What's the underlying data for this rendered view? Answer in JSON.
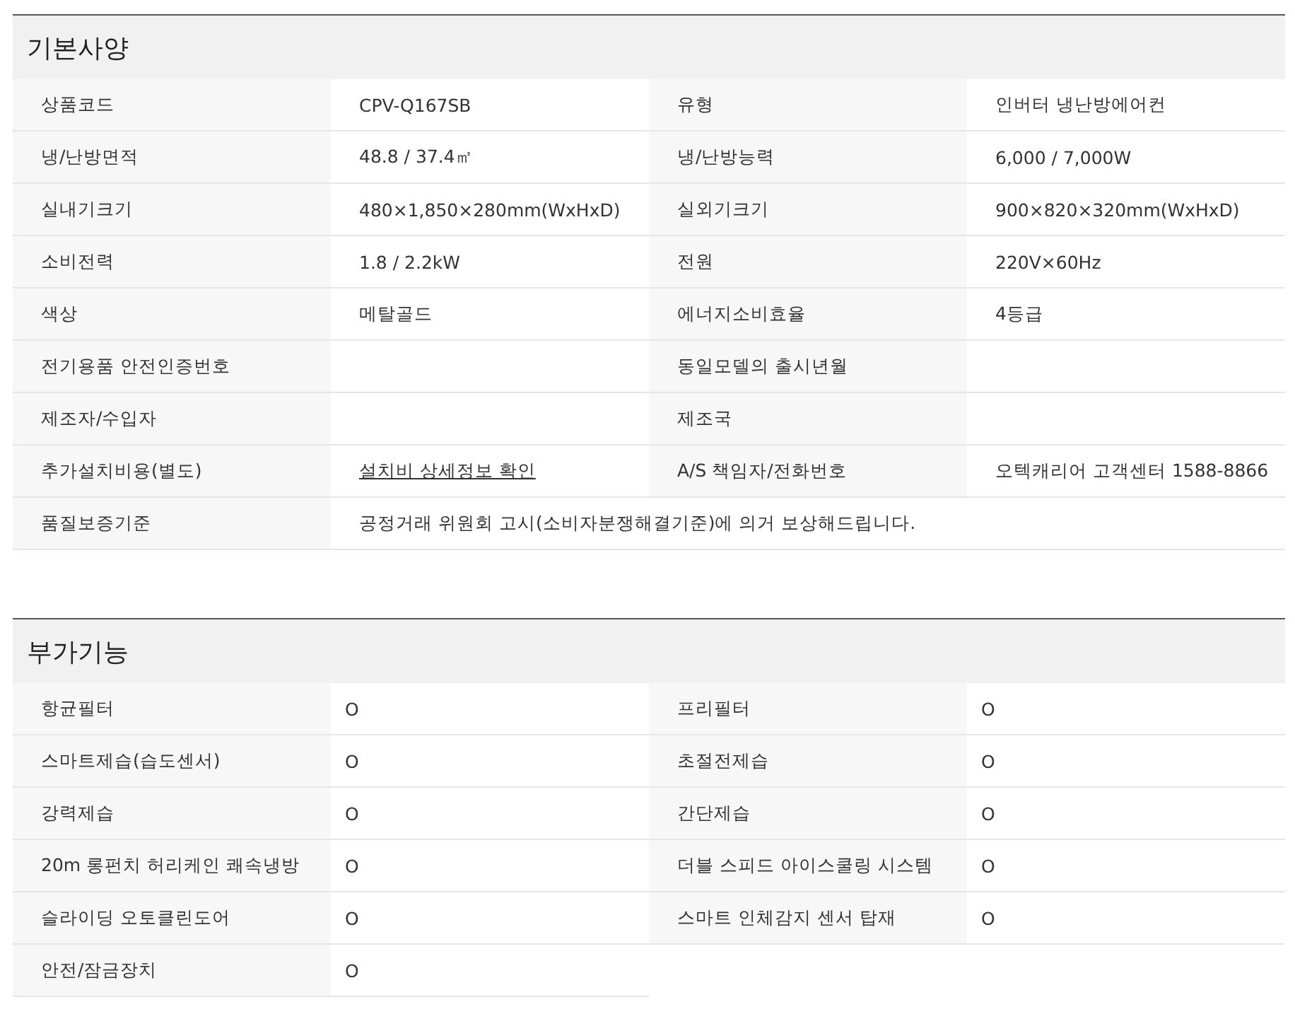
{
  "spec": {
    "title": "기본사양",
    "items": [
      {
        "label": "상품코드",
        "value": "CPV-Q167SB"
      },
      {
        "label": "유형",
        "value": "인버터 냉난방에어컨"
      },
      {
        "label": "냉/난방면적",
        "value": "48.8 / 37.4㎡"
      },
      {
        "label": "냉/난방능력",
        "value": "6,000 / 7,000W"
      },
      {
        "label": "실내기크기",
        "value": "480×1,850×280mm(WxHxD)"
      },
      {
        "label": "실외기크기",
        "value": "900×820×320mm(WxHxD)"
      },
      {
        "label": "소비전력",
        "value": "1.8 / 2.2kW"
      },
      {
        "label": "전원",
        "value": "220V×60Hz"
      },
      {
        "label": "색상",
        "value": "메탈골드"
      },
      {
        "label": "에너지소비효율",
        "value": "4등급"
      },
      {
        "label": "전기용품 안전인증번호"
      },
      {
        "label": "동일모델의 출시년월"
      },
      {
        "label": "제조자/수입자"
      },
      {
        "label": "제조국"
      },
      {
        "label": "추가설치비용(별도)",
        "value": "설치비 상세정보 확인",
        "kind": "link"
      },
      {
        "label": "A/S 책임자/전화번호",
        "value": "오텍캐리어 고객센터 1588-8866"
      },
      {
        "label": "품질보증기준",
        "value": "공정거래 위원회 고시(소비자분쟁해결기준)에 의거 보상해드립니다.",
        "kind": "wide"
      }
    ]
  },
  "features": {
    "title": "부가기능",
    "items": [
      {
        "label": "항균필터",
        "value": "O"
      },
      {
        "label": "프리필터",
        "value": "O"
      },
      {
        "label": "스마트제습(습도센서)",
        "value": "O"
      },
      {
        "label": "초절전제습",
        "value": "O"
      },
      {
        "label": "강력제습",
        "value": "O"
      },
      {
        "label": "간단제습",
        "value": "O"
      },
      {
        "label": "20m 롱펀치 허리케인 쾌속냉방",
        "value": "O"
      },
      {
        "label": "더블 스피드 아이스쿨링 시스템",
        "value": "O"
      },
      {
        "label": "슬라이딩 오토클린도어",
        "value": "O"
      },
      {
        "label": "스마트 인체감지 센서 탑재",
        "value": "O"
      },
      {
        "label": "안전/잠금장치",
        "value": "O"
      }
    ]
  }
}
